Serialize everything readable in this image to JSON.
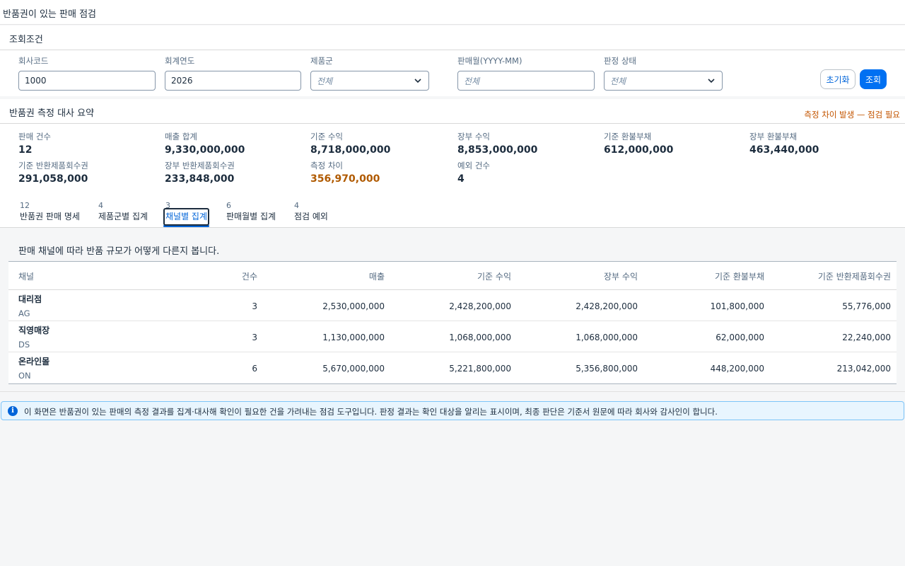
{
  "page": {
    "title": "반품권이 있는 판매 점검"
  },
  "filters": {
    "title": "조회조건",
    "company_code": {
      "label": "회사코드",
      "value": "1000"
    },
    "fiscal_year": {
      "label": "회계연도",
      "value": "2026"
    },
    "product_group": {
      "label": "제품군",
      "placeholder": "전체"
    },
    "sales_month": {
      "label": "판매월(YYYY-MM)",
      "placeholder": "전체"
    },
    "judgment_status": {
      "label": "판정 상태",
      "placeholder": "전체"
    },
    "reset_label": "초기화",
    "search_label": "조회"
  },
  "summary": {
    "title": "반품권 측정 대사 요약",
    "warning": "측정 차이 발생 — 점검 필요",
    "kpis": [
      {
        "label": "판매 건수",
        "value": "12"
      },
      {
        "label": "매출 합계",
        "value": "9,330,000,000"
      },
      {
        "label": "기준 수익",
        "value": "8,718,000,000"
      },
      {
        "label": "장부 수익",
        "value": "8,853,000,000"
      },
      {
        "label": "기준 환불부채",
        "value": "612,000,000"
      },
      {
        "label": "장부 환불부채",
        "value": "463,440,000"
      },
      {
        "label": "기준 반환제품회수권",
        "value": "291,058,000"
      },
      {
        "label": "장부 반환제품회수권",
        "value": "233,848,000"
      },
      {
        "label": "측정 차이",
        "value": "356,970,000"
      },
      {
        "label": "예외 건수",
        "value": "4"
      }
    ]
  },
  "tabs": [
    {
      "count": "12",
      "label": "반품권 판매 명세"
    },
    {
      "count": "4",
      "label": "제품군별 집계"
    },
    {
      "count": "3",
      "label": "채널별 집계"
    },
    {
      "count": "6",
      "label": "판매월별 집계"
    },
    {
      "count": "4",
      "label": "점검 예외"
    }
  ],
  "channel_view": {
    "description": "판매 채널에 따라 반품 규모가 어떻게 다른지 봅니다.",
    "columns": [
      "채널",
      "건수",
      "매출",
      "기준 수익",
      "장부 수익",
      "기준 환불부채",
      "기준 반환제품회수권"
    ],
    "rows": [
      {
        "name": "대리점",
        "code": "AG",
        "count": "3",
        "sales": "2,530,000,000",
        "std_revenue": "2,428,200,000",
        "book_revenue": "2,428,200,000",
        "refund_liability": "101,800,000",
        "return_asset": "55,776,000"
      },
      {
        "name": "직영매장",
        "code": "DS",
        "count": "3",
        "sales": "1,130,000,000",
        "std_revenue": "1,068,000,000",
        "book_revenue": "1,068,000,000",
        "refund_liability": "62,000,000",
        "return_asset": "22,240,000"
      },
      {
        "name": "온라인몰",
        "code": "ON",
        "count": "6",
        "sales": "5,670,000,000",
        "std_revenue": "5,221,800,000",
        "book_revenue": "5,356,800,000",
        "refund_liability": "448,200,000",
        "return_asset": "213,042,000"
      }
    ]
  },
  "notice": {
    "text": "이 화면은 반품권이 있는 판매의 측정 결과를 집계·대사해 확인이 필요한 건을 가려내는 점검 도구입니다. 판정 결과는 확인 대상을 알리는 표시이며, 최종 판단은 기준서 원문에 따라 회사와 감사인이 합니다."
  },
  "colors": {
    "accent": "#0070f2",
    "warning": "#c35500",
    "difference": "#b05a00",
    "info_bg": "#e8f5fe"
  }
}
